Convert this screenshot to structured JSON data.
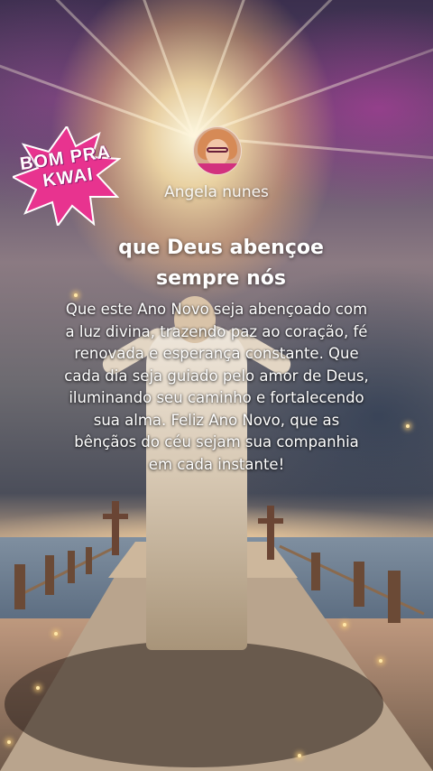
{
  "badge": {
    "line1": "BOM PRA",
    "line2": "KWAI"
  },
  "author": {
    "name": "Angela nunes"
  },
  "post": {
    "title": "que Deus abençoe sempre nós",
    "body": "Que este Ano Novo seja abençoado com a luz divina, trazendo paz ao coração, fé renovada e esperança constante. Que cada dia seja guiado pelo amor de Deus, iluminando seu caminho e fortalecendo sua alma. Feliz Ano Novo, que as bênçãos do céu sejam sua companhia em cada instante!"
  },
  "colors": {
    "badge_pink": "#e8338f",
    "text": "#ffffff"
  }
}
